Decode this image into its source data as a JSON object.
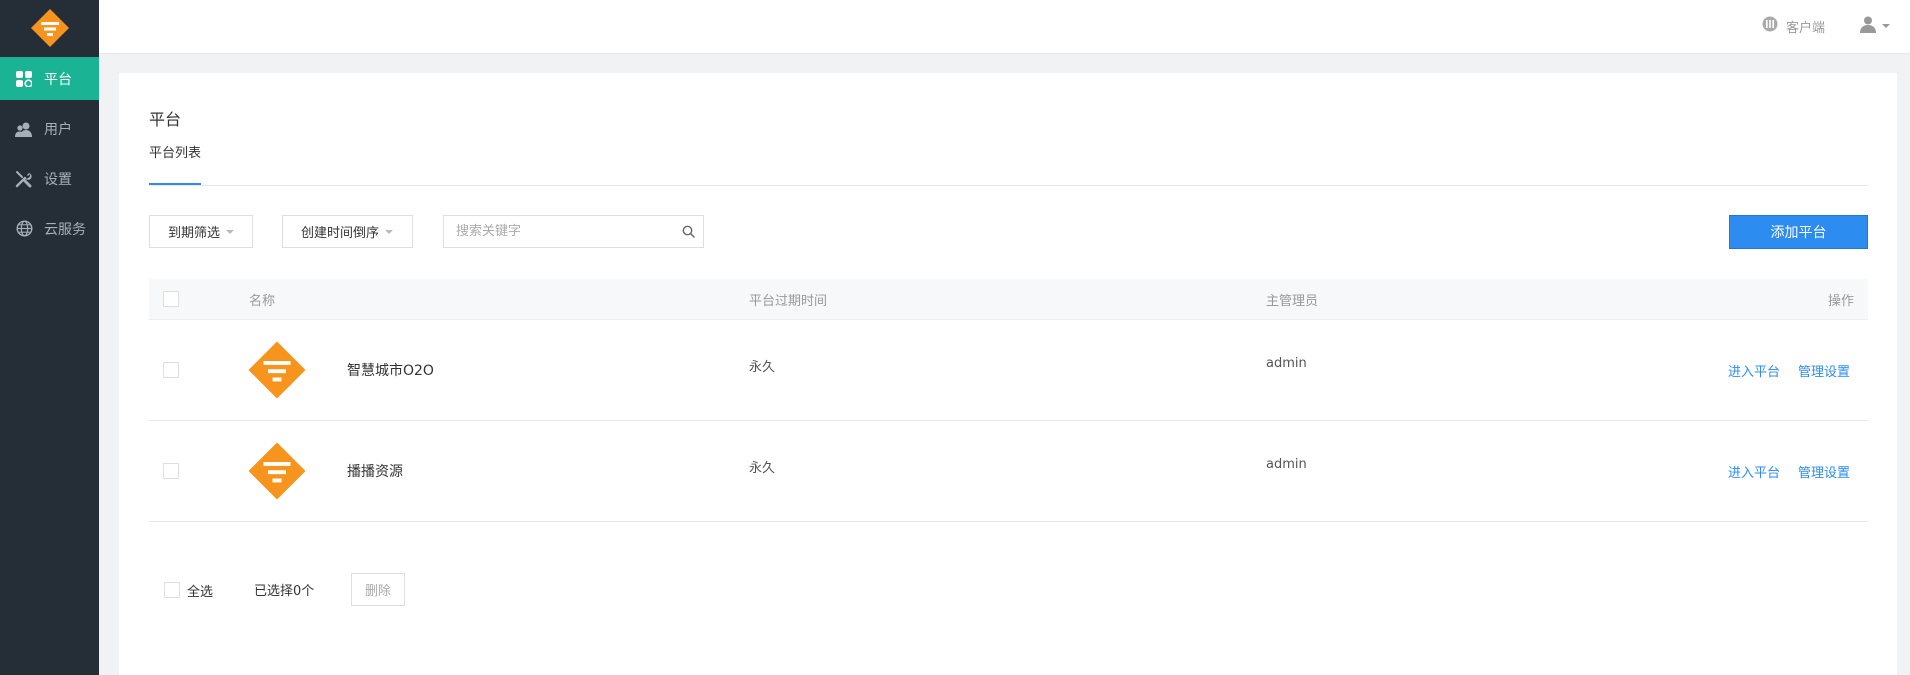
{
  "sidebar": {
    "items": [
      {
        "label": "平台",
        "icon": "platform-icon",
        "active": true
      },
      {
        "label": "用户",
        "icon": "users-icon",
        "active": false
      },
      {
        "label": "设置",
        "icon": "tools-icon",
        "active": false
      },
      {
        "label": "云服务",
        "icon": "globe-icon",
        "active": false
      }
    ]
  },
  "topbar": {
    "client_label": "客户端"
  },
  "page": {
    "title": "平台",
    "tabs": [
      {
        "label": "平台列表",
        "active": true
      }
    ]
  },
  "toolbar": {
    "filter_expire": "到期筛选",
    "sort_order": "创建时间倒序",
    "search_placeholder": "搜索关键字",
    "add_button": "添加平台"
  },
  "table": {
    "headers": {
      "name": "名称",
      "expire": "平台过期时间",
      "admin": "主管理员",
      "actions": "操作"
    },
    "rows": [
      {
        "name": "智慧城市O2O",
        "expire": "永久",
        "admin": "admin",
        "enter": "进入平台",
        "manage": "管理设置"
      },
      {
        "name": "播播资源",
        "expire": "永久",
        "admin": "admin",
        "enter": "进入平台",
        "manage": "管理设置"
      }
    ]
  },
  "footer": {
    "select_all": "全选",
    "selected_count": "已选择0个",
    "delete_button": "删除"
  },
  "colors": {
    "sidebar_bg": "#252d37",
    "active_green": "#1ab394",
    "primary_blue": "#2d8cf0",
    "brand_orange": "#f7941d"
  }
}
